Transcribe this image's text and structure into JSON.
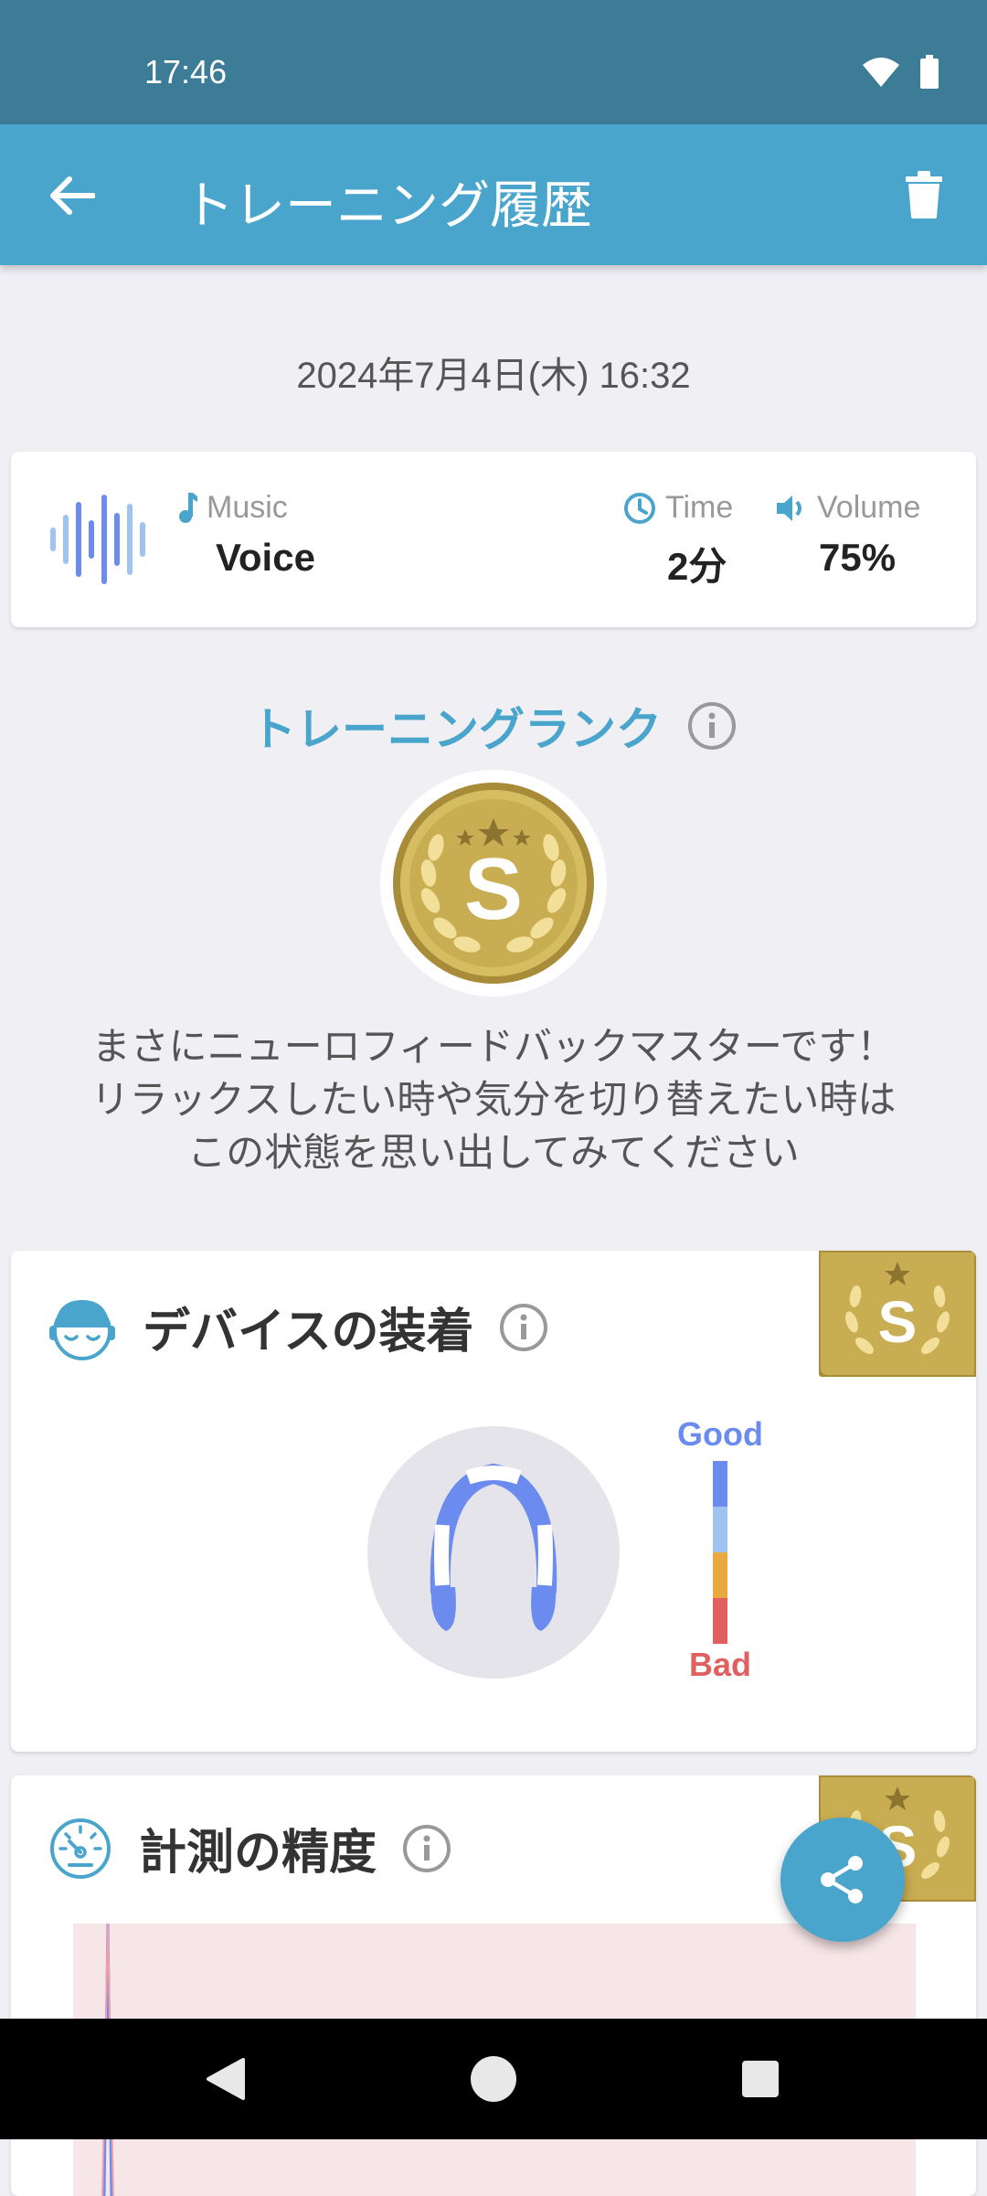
{
  "status": {
    "time": "17:46"
  },
  "app_bar": {
    "title": "トレーニング履歴"
  },
  "session": {
    "datetime": "2024年7月4日(木) 16:32",
    "music_label": "Music",
    "music_value": "Voice",
    "time_label": "Time",
    "time_value": "2分",
    "volume_label": "Volume",
    "volume_value": "75%"
  },
  "rank": {
    "title": "トレーニングランク",
    "grade": "S",
    "message_lines": [
      "まさにニューロフィードバックマスターです！",
      "リラックスしたい時や気分を切り替えたい時は",
      "この状態を思い出してみてください"
    ]
  },
  "device_fit": {
    "title": "デバイスの装着",
    "badge": "S",
    "scale_good": "Good",
    "scale_bad": "Bad"
  },
  "accuracy": {
    "title": "計測の精度",
    "badge": "S"
  },
  "colors": {
    "status_bar": "#3c7c96",
    "app_bar": "#4aa5cc",
    "accent": "#4aa5cc",
    "gold": "#c8ac4e",
    "good": "#6b8cee",
    "bad": "#e06060"
  }
}
